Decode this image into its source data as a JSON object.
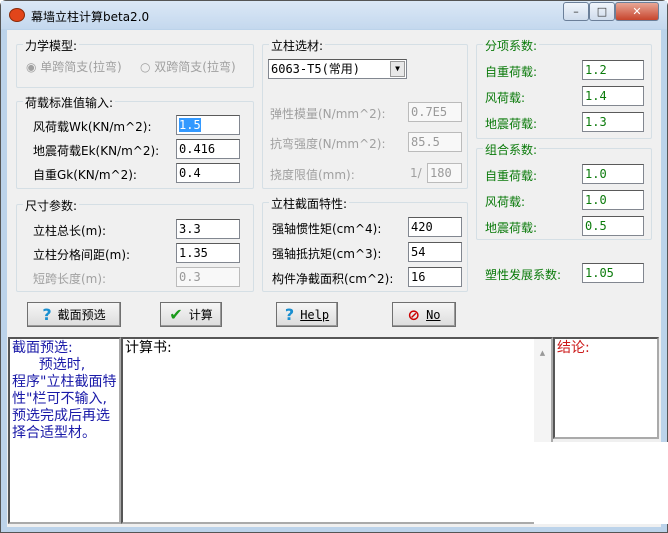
{
  "window": {
    "title": "幕墙立柱计算beta2.0",
    "min": "–",
    "max": "□",
    "close": "✕"
  },
  "model": {
    "legend": "力学模型:",
    "opt1": "单跨简支(拉弯)",
    "opt2": "双跨简支(拉弯)",
    "selected": "opt1"
  },
  "loads": {
    "legend": "荷载标准值输入:",
    "rows": [
      {
        "label": "风荷载Wk(KN/m^2):",
        "value": "1.5"
      },
      {
        "label": "地震荷载Ek(KN/m^2):",
        "value": "0.416"
      },
      {
        "label": "自重Gk(KN/m^2):",
        "value": "0.4"
      }
    ]
  },
  "dims": {
    "legend": "尺寸参数:",
    "rows": [
      {
        "label": "立柱总长(m):",
        "value": "3.3"
      },
      {
        "label": "立柱分格间距(m):",
        "value": "1.35"
      },
      {
        "label": "短跨长度(m):",
        "value": "0.3"
      }
    ]
  },
  "material": {
    "legend": "立柱选材:",
    "select": "6063-T5(常用)",
    "rows": [
      {
        "label": "弹性模量(N/mm^2):",
        "value": "0.7E5"
      },
      {
        "label": "抗弯强度(N/mm^2):",
        "value": "85.5"
      },
      {
        "label": "挠度限值(mm):",
        "prefix": "1/",
        "value": "180"
      }
    ]
  },
  "section": {
    "legend": "立柱截面特性:",
    "rows": [
      {
        "label": "强轴惯性矩(cm^4):",
        "value": "420"
      },
      {
        "label": "强轴抵抗矩(cm^3):",
        "value": "54"
      },
      {
        "label": "构件净截面积(cm^2):",
        "value": "16"
      }
    ]
  },
  "partial": {
    "legend": "分项系数:",
    "rows": [
      {
        "label": "自重荷载:",
        "value": "1.2"
      },
      {
        "label": "风荷载:",
        "value": "1.4"
      },
      {
        "label": "地震荷载:",
        "value": "1.3"
      }
    ]
  },
  "combo": {
    "legend": "组合系数:",
    "rows": [
      {
        "label": "自重荷载:",
        "value": "1.0"
      },
      {
        "label": "风荷载:",
        "value": "1.0"
      },
      {
        "label": "地震荷载:",
        "value": "0.5"
      }
    ]
  },
  "plastic": {
    "label": "塑性发展系数:",
    "value": "1.05"
  },
  "buttons": {
    "preselect": "截面预选",
    "calc": "计算",
    "help": "Help",
    "no": "No"
  },
  "panes": {
    "hint": "截面预选:\n      预选时,\n程序\"立柱截面特性\"栏可不输入,预选完成后再选择合适型材。",
    "calc": "计算书:",
    "conclusion": "结论:"
  },
  "colors": {
    "hint": "#1a1aa8",
    "conclusion": "#cc1a1a",
    "green": "#0a7a0a"
  }
}
